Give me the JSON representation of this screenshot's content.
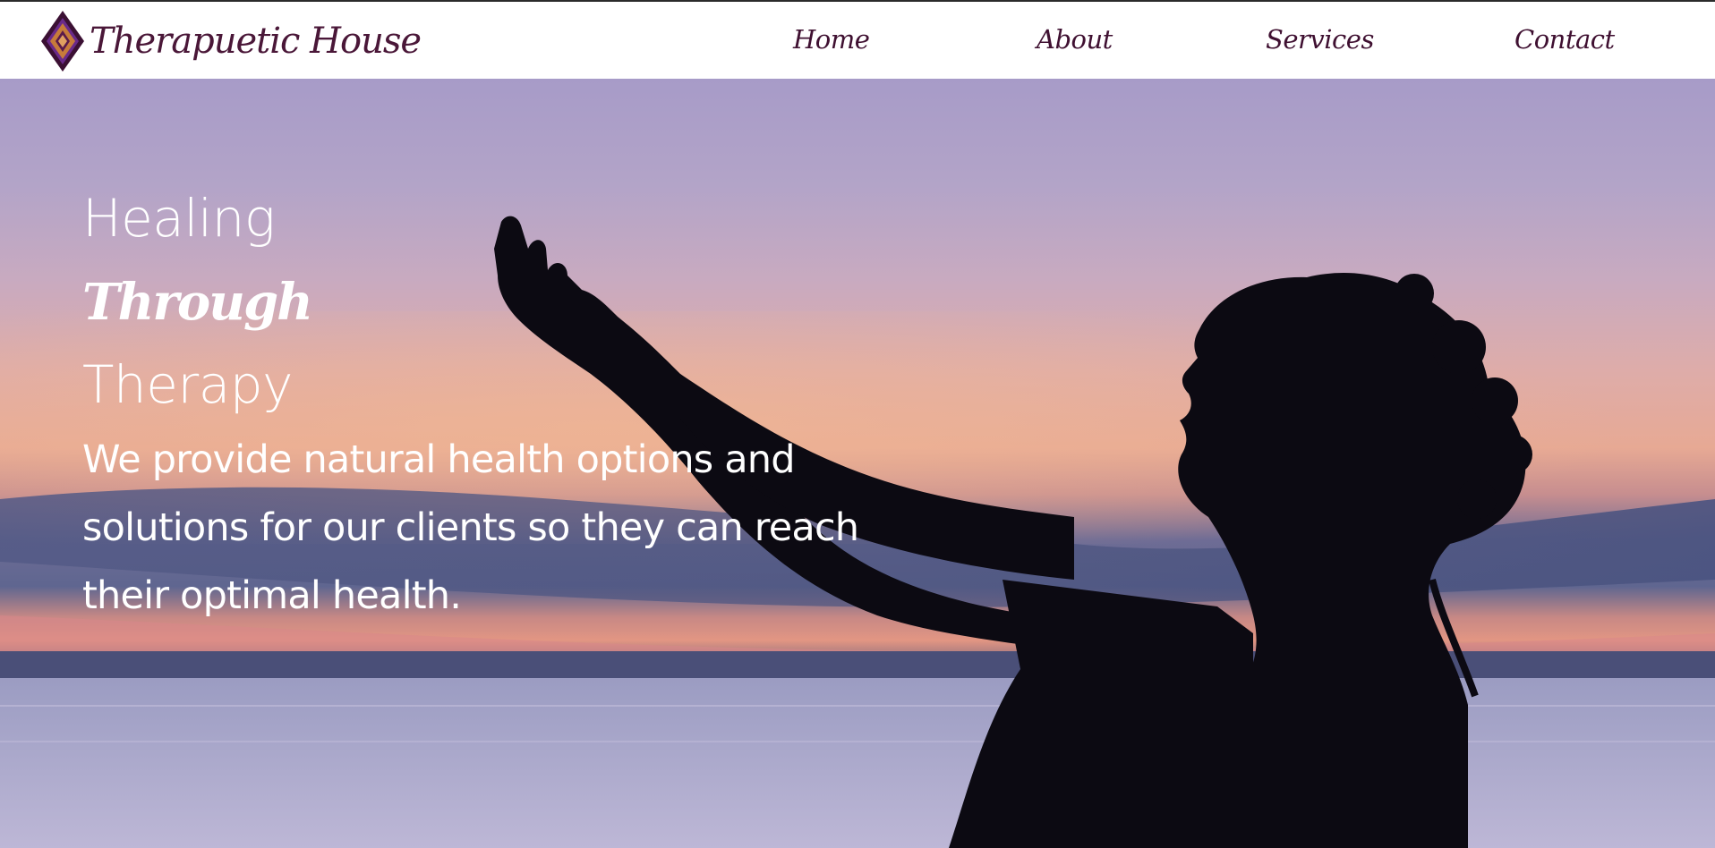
{
  "brand": {
    "name": "Therapuetic House",
    "logo_icon": "diamond-logo-icon",
    "colors": {
      "brand": "#4a1738",
      "logo_outer": "#3b1033",
      "logo_inner": "#c77b3a",
      "logo_accent": "#6a2a8a"
    }
  },
  "nav": {
    "items": [
      {
        "label": "Home"
      },
      {
        "label": "About"
      },
      {
        "label": "Services"
      },
      {
        "label": "Contact"
      }
    ]
  },
  "hero": {
    "heading": {
      "line1": "Healing",
      "line2": "Through",
      "line3": "Therapy"
    },
    "description": "We provide natural health options and solutions for our clients so they can reach their optimal health.",
    "background_description_colors": {
      "sky_top": "#a79bc8",
      "sunset": "#e7a994",
      "water": "#a7a6c9",
      "silhouette": "#0c0a12"
    }
  }
}
